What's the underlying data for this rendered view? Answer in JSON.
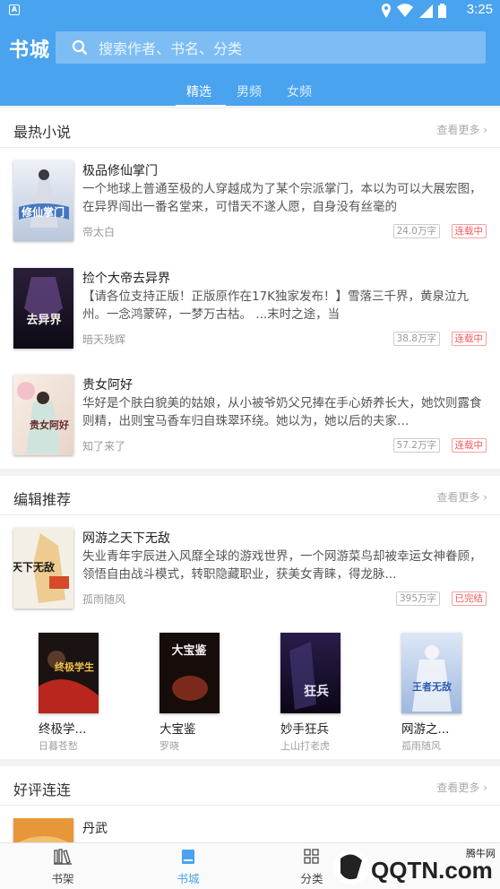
{
  "statusbar": {
    "time": "3:25",
    "app_indicator": "A"
  },
  "header": {
    "logo": "书城",
    "search_placeholder": "搜索作者、书名、分类",
    "tabs": [
      {
        "label": "精选",
        "active": true
      },
      {
        "label": "男频",
        "active": false
      },
      {
        "label": "女频",
        "active": false
      }
    ]
  },
  "sections": {
    "hot": {
      "title": "最热小说",
      "more": "查看更多",
      "books": [
        {
          "title": "极品修仙掌门",
          "desc": "一个地球上普通至极的人穿越成为了某个宗派掌门，本以为可以大展宏图，在异界闯出一番名堂来，可惜天不遂人愿，自身没有丝毫的",
          "author": "帝太白",
          "words": "24.0万字",
          "status": "连载中",
          "cover_text": "修仙掌门"
        },
        {
          "title": "捡个大帝去异界",
          "desc": "【请各位支持正版！正版原作在17K独家发布！】雪落三千界，黄泉泣九州。一念鸿蒙碎，一梦万古枯。 ...末时之途，当",
          "author": "暗天残辉",
          "words": "38.8万字",
          "status": "连载中",
          "cover_text": "去异界"
        },
        {
          "title": "贵女阿好",
          "desc": "华好是个肤白貌美的姑娘，从小被爷奶父兄捧在手心娇养长大，她饮则露食则精，出则宝马香车归自珠翠环绕。她以为，她以后的夫家…",
          "author": "知了来了",
          "words": "57.2万字",
          "status": "连载中",
          "cover_text": "贵女阿好"
        }
      ]
    },
    "editor": {
      "title": "编辑推荐",
      "more": "查看更多",
      "featured": {
        "title": "网游之天下无敌",
        "desc": "失业青年宇辰进入风靡全球的游戏世界，一个网游菜鸟却被幸运女神眷顾，领悟自由战斗模式，转职隐藏职业，获美女青睐，得龙脉...",
        "author": "孤雨随风",
        "words": "395万字",
        "status": "已完结",
        "cover_text": "天下无敌"
      },
      "grid": [
        {
          "title": "终极学...",
          "author": "日暮苍愁",
          "cover_text": "终极学生"
        },
        {
          "title": "大宝鉴",
          "author": "罗晓",
          "cover_text": "大宝鉴"
        },
        {
          "title": "妙手狂兵",
          "author": "上山打老虎",
          "cover_text": "狂兵"
        },
        {
          "title": "网游之...",
          "author": "孤雨随风",
          "cover_text": "王者无敌"
        }
      ]
    },
    "praise": {
      "title": "好评连连",
      "more": "查看更多",
      "books": [
        {
          "title": "丹武"
        }
      ]
    }
  },
  "bottomnav": [
    {
      "label": "书架",
      "icon": "bookshelf-icon",
      "active": false
    },
    {
      "label": "书城",
      "icon": "bookstore-icon",
      "active": true
    },
    {
      "label": "分类",
      "icon": "category-icon",
      "active": false
    }
  ],
  "watermark": {
    "text": "QQTN.com",
    "site": "腾牛网"
  },
  "colors": {
    "accent": "#4aa3ee",
    "status_red": "#f25a5a"
  }
}
